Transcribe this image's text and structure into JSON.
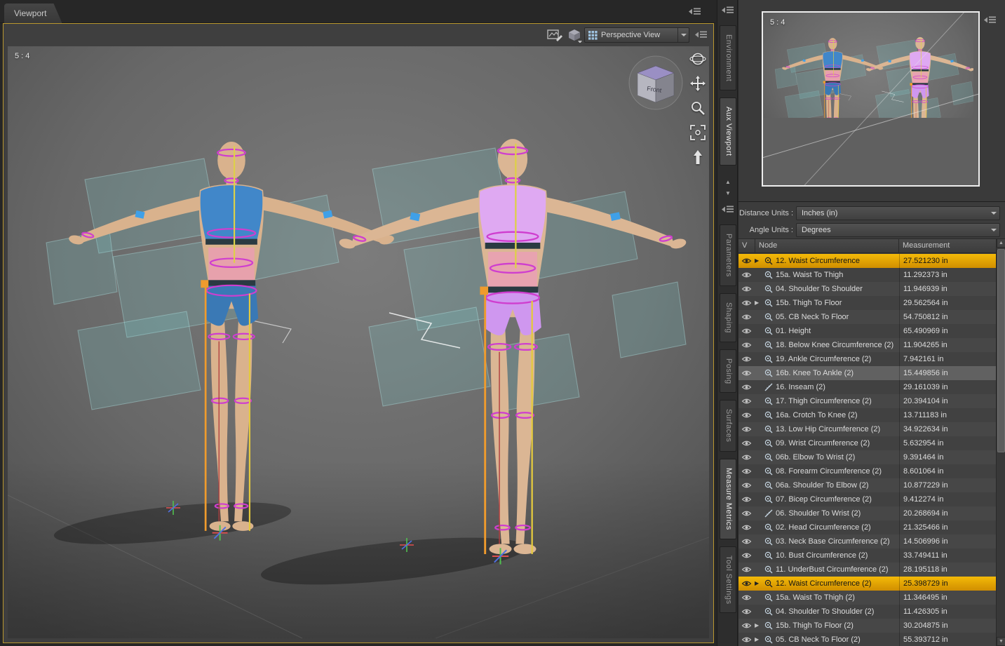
{
  "window": {
    "viewport_tab_label": "Viewport",
    "aspect_ratio_label": "5 : 4",
    "view_cube_front_label": "Front"
  },
  "viewport_toolbar": {
    "camera_dropdown_value": "Perspective View"
  },
  "aux_viewport": {
    "aspect_ratio_label": "5 : 4"
  },
  "side_tabs_top": [
    {
      "label": "Environment",
      "active": false
    },
    {
      "label": "Aux Viewport",
      "active": true
    }
  ],
  "side_tabs_bottom": [
    {
      "label": "Parameters",
      "active": false
    },
    {
      "label": "Shaping",
      "active": false
    },
    {
      "label": "Posing",
      "active": false
    },
    {
      "label": "Surfaces",
      "active": false
    },
    {
      "label": "Measure Metrics",
      "active": true
    },
    {
      "label": "Tool Settings",
      "active": false
    }
  ],
  "units_panel": {
    "distance_label": "Distance Units :",
    "distance_value": "Inches (in)",
    "angle_label": "Angle Units :",
    "angle_value": "Degrees"
  },
  "measurement_table": {
    "columns": {
      "visibility": "V",
      "node": "Node",
      "measurement": "Measurement"
    },
    "rows": [
      {
        "label": "12. Waist Circumference",
        "value": "27.521230 in",
        "icon": "tape",
        "arrow": true,
        "state": "highlight"
      },
      {
        "label": "15a. Waist To Thigh",
        "value": "11.292373 in",
        "icon": "tape"
      },
      {
        "label": "04. Shoulder To Shoulder",
        "value": "11.946939 in",
        "icon": "tape"
      },
      {
        "label": "15b. Thigh To Floor",
        "value": "29.562564 in",
        "icon": "tape",
        "arrow": true
      },
      {
        "label": "05. CB Neck To Floor",
        "value": "54.750812 in",
        "icon": "tape"
      },
      {
        "label": "01. Height",
        "value": "65.490969 in",
        "icon": "tape"
      },
      {
        "label": "18. Below Knee Circumference (2)",
        "value": "11.904265 in",
        "icon": "tape"
      },
      {
        "label": "19. Ankle Circumference (2)",
        "value": "7.942161 in",
        "icon": "tape"
      },
      {
        "label": "16b. Knee To Ankle (2)",
        "value": "15.449856 in",
        "icon": "tape",
        "state": "selected"
      },
      {
        "label": "16. Inseam (2)",
        "value": "29.161039 in",
        "icon": "ruler"
      },
      {
        "label": "17. Thigh Circumference (2)",
        "value": "20.394104 in",
        "icon": "tape"
      },
      {
        "label": "16a. Crotch To Knee (2)",
        "value": "13.711183 in",
        "icon": "tape"
      },
      {
        "label": "13. Low Hip Circumference (2)",
        "value": "34.922634 in",
        "icon": "tape"
      },
      {
        "label": "09. Wrist Circumference (2)",
        "value": "5.632954 in",
        "icon": "tape"
      },
      {
        "label": "06b. Elbow To Wrist (2)",
        "value": "9.391464 in",
        "icon": "tape"
      },
      {
        "label": "08. Forearm Circumference (2)",
        "value": "8.601064 in",
        "icon": "tape"
      },
      {
        "label": "06a. Shoulder To Elbow (2)",
        "value": "10.877229 in",
        "icon": "tape"
      },
      {
        "label": "07. Bicep Circumference (2)",
        "value": "9.412274 in",
        "icon": "tape"
      },
      {
        "label": "06. Shoulder To Wrist (2)",
        "value": "20.268694 in",
        "icon": "ruler"
      },
      {
        "label": "02. Head Circumference (2)",
        "value": "21.325466 in",
        "icon": "tape"
      },
      {
        "label": "03. Neck Base Circumference (2)",
        "value": "14.506996 in",
        "icon": "tape"
      },
      {
        "label": "10. Bust Circumference (2)",
        "value": "33.749411 in",
        "icon": "tape"
      },
      {
        "label": "11. UnderBust Circumference (2)",
        "value": "28.195118 in",
        "icon": "tape"
      },
      {
        "label": "12. Waist Circumference (2)",
        "value": "25.398729 in",
        "icon": "tape",
        "arrow": true,
        "state": "highlight"
      },
      {
        "label": "15a. Waist To Thigh (2)",
        "value": "11.346495 in",
        "icon": "tape"
      },
      {
        "label": "04. Shoulder To Shoulder (2)",
        "value": "11.426305 in",
        "icon": "tape"
      },
      {
        "label": "15b. Thigh To Floor (2)",
        "value": "30.204875 in",
        "icon": "tape",
        "arrow": true
      },
      {
        "label": "05. CB Neck To Floor (2)",
        "value": "55.393712 in",
        "icon": "tape",
        "arrow": true
      }
    ]
  },
  "scene": {
    "figure_1_outfit_color": "#4187c9",
    "figure_2_outfit_color": "#dfa9f2",
    "measure_ring_color": "#cf3ecf",
    "measure_zone_color": "#f394c6",
    "guide_line_color": "#ef9b2d"
  },
  "colors": {
    "active_viewport_border": "#b9972e",
    "row_highlight": "#e8a400",
    "row_selected": "#616161",
    "panel_background": "#3c3c3c"
  },
  "icons": {
    "pane_menu": "pane-menu-icon",
    "visibility": "visibility-eye-icon",
    "expand": "expand-arrow-icon",
    "tape_measure": "tape-measure-icon",
    "ruler": "ruler-icon",
    "orbit": "orbit-icon",
    "pan": "pan-icon",
    "zoom": "zoom-icon",
    "frame": "frame-icon",
    "camera_up": "camera-up-icon",
    "viewport_layout": "viewport-layout-icon",
    "render_settings": "render-settings-icon",
    "camera_cube": "camera-cube-icon"
  }
}
